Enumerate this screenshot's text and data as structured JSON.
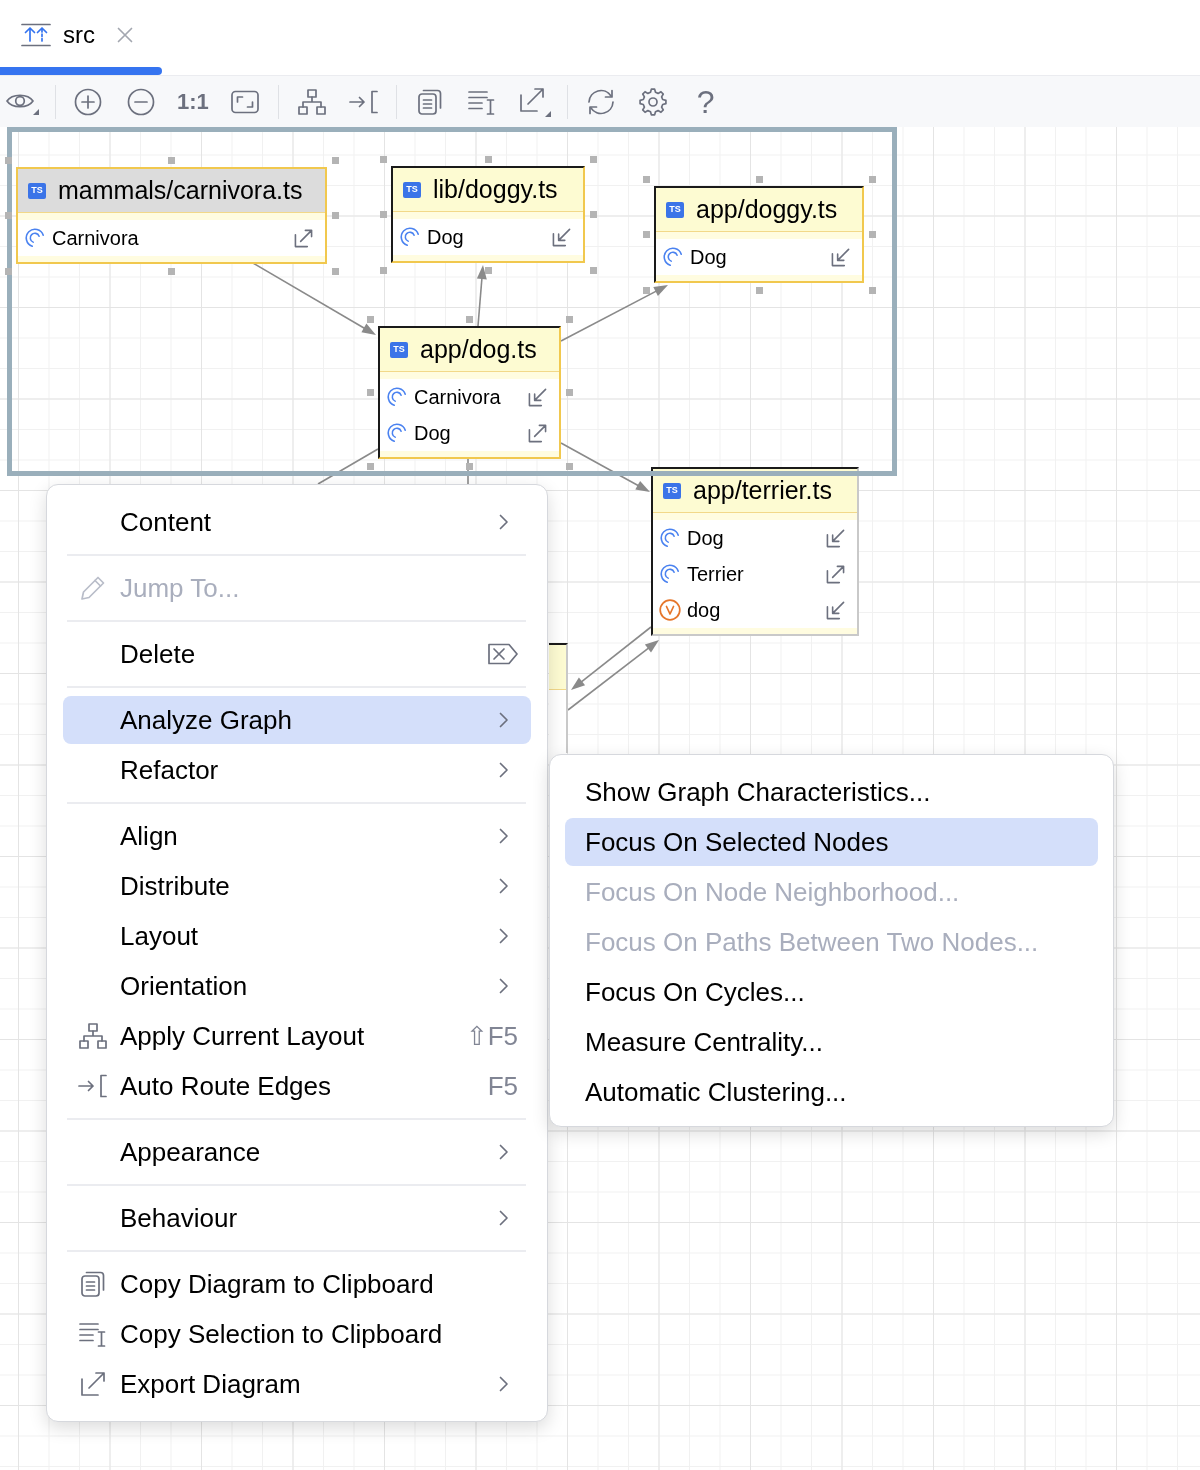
{
  "tab": {
    "label": "src",
    "selected": true
  },
  "toolbar": {
    "zoom_label": "1:1",
    "help_label": "?"
  },
  "nodes": [
    {
      "title": "mammals/carnivora.ts",
      "badge": "TS",
      "focused": true,
      "selected": true,
      "members": [
        {
          "name": "Carnivora",
          "kind": "class",
          "export": true
        }
      ]
    },
    {
      "title": "lib/doggy.ts",
      "badge": "TS",
      "focused": false,
      "selected": true,
      "members": [
        {
          "name": "Dog",
          "kind": "class",
          "export": false
        }
      ]
    },
    {
      "title": "app/doggy.ts",
      "badge": "TS",
      "focused": false,
      "selected": true,
      "members": [
        {
          "name": "Dog",
          "kind": "class",
          "export": false
        }
      ]
    },
    {
      "title": "app/dog.ts",
      "badge": "TS",
      "focused": false,
      "selected": true,
      "members": [
        {
          "name": "Carnivora",
          "kind": "class",
          "export": false
        },
        {
          "name": "Dog",
          "kind": "class",
          "export": true
        }
      ]
    },
    {
      "title": "app/terrier.ts",
      "badge": "TS",
      "focused": false,
      "selected": false,
      "members": [
        {
          "name": "Dog",
          "kind": "class",
          "export": false
        },
        {
          "name": "Terrier",
          "kind": "class",
          "export": true
        },
        {
          "name": "dog",
          "kind": "variable",
          "export": false
        }
      ]
    }
  ],
  "context_menu": {
    "sections": [
      {
        "items": [
          {
            "label": "Content",
            "submenu": true,
            "disabled": false,
            "selected": false
          }
        ]
      },
      {
        "items": [
          {
            "label": "Jump To...",
            "submenu": false,
            "disabled": true,
            "selected": false
          }
        ]
      },
      {
        "items": [
          {
            "label": "Delete",
            "submenu": false,
            "disabled": false,
            "selected": false
          }
        ]
      },
      {
        "items": [
          {
            "label": "Analyze Graph",
            "submenu": true,
            "disabled": false,
            "selected": true
          },
          {
            "label": "Refactor",
            "submenu": true,
            "disabled": false,
            "selected": false
          }
        ]
      },
      {
        "items": [
          {
            "label": "Align",
            "submenu": true,
            "disabled": false,
            "selected": false
          },
          {
            "label": "Distribute",
            "submenu": true,
            "disabled": false,
            "selected": false
          },
          {
            "label": "Layout",
            "submenu": true,
            "disabled": false,
            "selected": false
          },
          {
            "label": "Orientation",
            "submenu": true,
            "disabled": false,
            "selected": false
          },
          {
            "label": "Apply Current Layout",
            "shortcut": "⇧F5",
            "submenu": false,
            "disabled": false,
            "selected": false
          },
          {
            "label": "Auto Route Edges",
            "shortcut": "F5",
            "submenu": false,
            "disabled": false,
            "selected": false
          }
        ]
      },
      {
        "items": [
          {
            "label": "Appearance",
            "submenu": true,
            "disabled": false,
            "selected": false
          }
        ]
      },
      {
        "items": [
          {
            "label": "Behaviour",
            "submenu": true,
            "disabled": false,
            "selected": false
          }
        ]
      },
      {
        "items": [
          {
            "label": "Copy Diagram to Clipboard",
            "submenu": false,
            "disabled": false,
            "selected": false
          },
          {
            "label": "Copy Selection to Clipboard",
            "submenu": false,
            "disabled": false,
            "selected": false
          },
          {
            "label": "Export Diagram",
            "submenu": true,
            "disabled": false,
            "selected": false
          }
        ]
      }
    ]
  },
  "submenu": {
    "items": [
      {
        "label": "Show Graph Characteristics...",
        "disabled": false,
        "selected": false
      },
      {
        "label": "Focus On Selected Nodes",
        "disabled": false,
        "selected": true
      },
      {
        "label": "Focus On Node Neighborhood...",
        "disabled": true,
        "selected": false
      },
      {
        "label": "Focus On Paths Between Two Nodes...",
        "disabled": true,
        "selected": false
      },
      {
        "label": "Focus On Cycles...",
        "disabled": false,
        "selected": false
      },
      {
        "label": "Measure Centrality...",
        "disabled": false,
        "selected": false
      },
      {
        "label": "Automatic Clustering...",
        "disabled": false,
        "selected": false
      }
    ]
  }
}
